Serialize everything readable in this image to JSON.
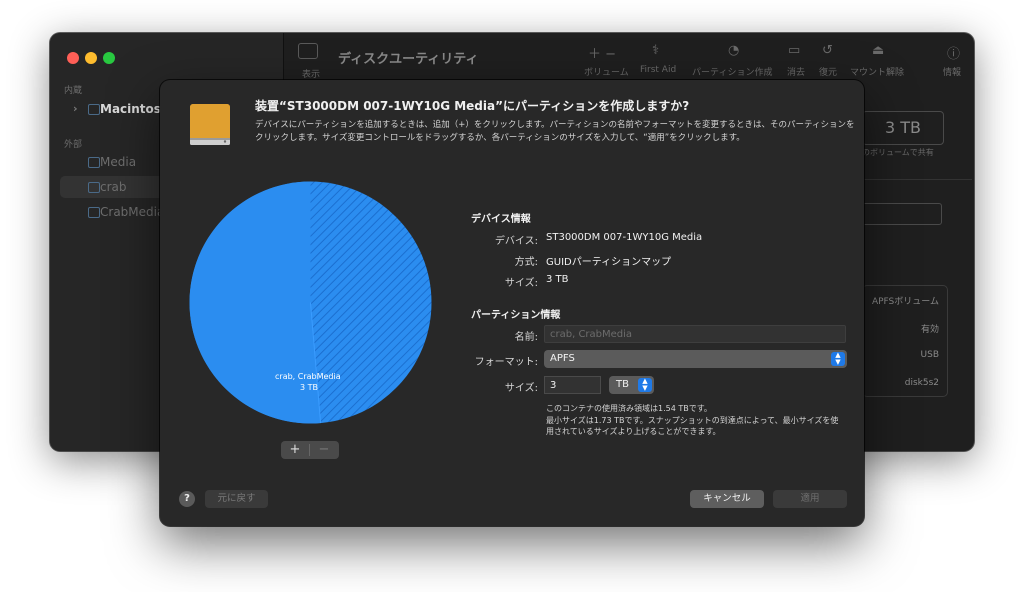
{
  "background_window": {
    "title": "ディスクユーティリティ",
    "view_label": "表示",
    "sidebar": {
      "internal_label": "内蔵",
      "internal_items": [
        {
          "label": "Macintosh"
        }
      ],
      "external_label": "外部",
      "external_items": [
        {
          "label": "Media"
        },
        {
          "label": "crab"
        },
        {
          "label": "CrabMedia"
        }
      ]
    },
    "toolbar": [
      {
        "label": "ボリューム",
        "icon": "plus-minus-icon"
      },
      {
        "label": "First Aid",
        "icon": "stethoscope-icon"
      },
      {
        "label": "パーティション作成",
        "icon": "pie-chart-icon"
      },
      {
        "label": "消去",
        "icon": "erase-icon"
      },
      {
        "label": "復元",
        "icon": "restore-icon"
      },
      {
        "label": "マウント解除",
        "icon": "eject-icon"
      },
      {
        "label": "情報",
        "icon": "info-icon"
      }
    ],
    "size_value": "3 TB",
    "shared_note": "のボリュームで共有",
    "info_rows": [
      "APFSボリューム",
      "有効",
      "USB",
      "disk5s2"
    ]
  },
  "dialog": {
    "title": "装置“ST3000DM 007-1WY10G Media”にパーティションを作成しますか?",
    "description": "デバイスにパーティションを追加するときは、追加（+）をクリックします。パーティションの名前やフォーマットを変更するときは、そのパーティションをクリックします。サイズ変更コントロールをドラッグするか、各パーティションのサイズを入力して、“適用”をクリックします。",
    "pie": {
      "label_name": "crab, CrabMedia",
      "label_size": "3 TB",
      "color": "#2b8df0",
      "used_fraction": 0.5133
    },
    "add_button": "+",
    "remove_button": "−",
    "device_info": {
      "heading": "デバイス情報",
      "device_label": "デバイス:",
      "device_value": "ST3000DM 007-1WY10G Media",
      "scheme_label": "方式:",
      "scheme_value": "GUIDパーティションマップ",
      "size_label": "サイズ:",
      "size_value": "3 TB"
    },
    "partition_info": {
      "heading": "パーティション情報",
      "name_label": "名前:",
      "name_placeholder": "crab, CrabMedia",
      "format_label": "フォーマット:",
      "format_value": "APFS",
      "size_label": "サイズ:",
      "size_value": "3",
      "size_unit": "TB"
    },
    "note_line1": "このコンテナの使用済み領域は1.54 TBです。",
    "note_line2": "最小サイズは1.73 TBです。スナップショットの到達点によって、最小サイズを使用されているサイズより上げることができます。",
    "help_button": "?",
    "revert_button": "元に戻す",
    "cancel_button": "キャンセル",
    "apply_button": "適用"
  }
}
